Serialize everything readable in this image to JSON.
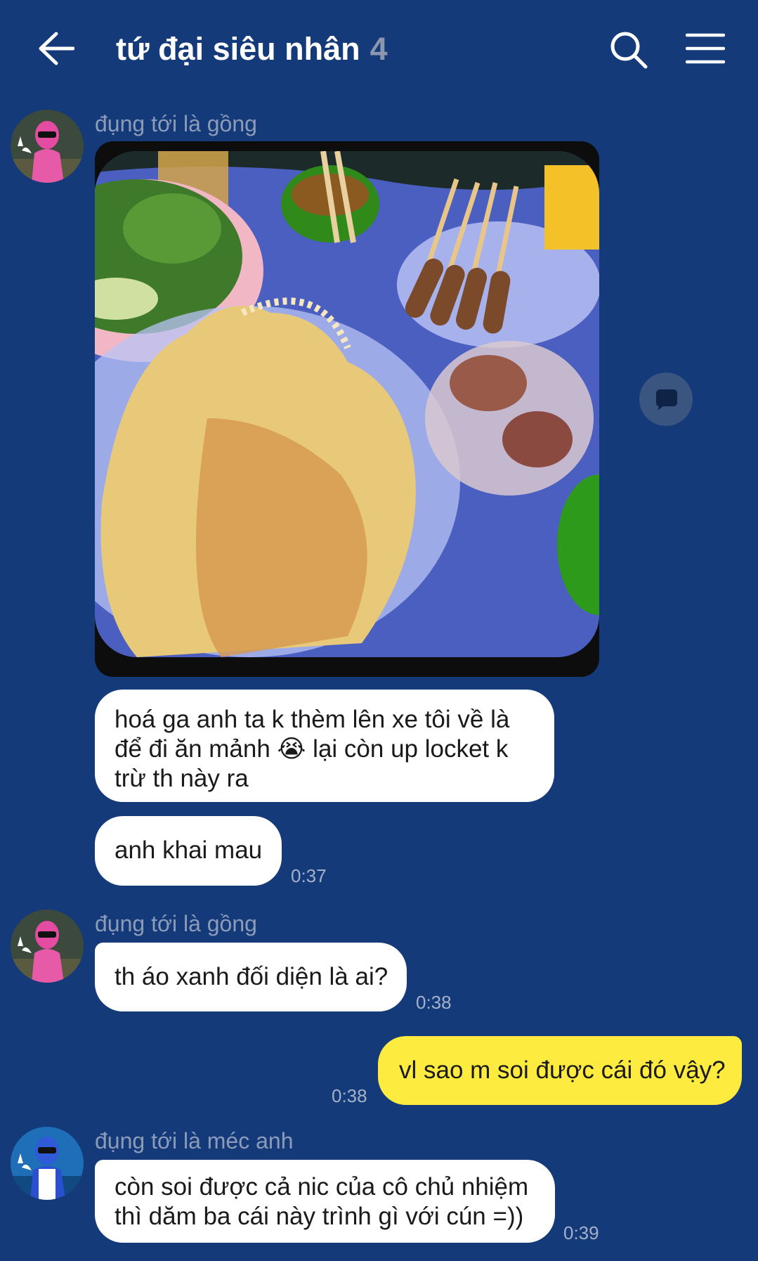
{
  "header": {
    "title": "tứ đại siêu nhân",
    "member_count": "4",
    "icons": {
      "back": "arrow-left-icon",
      "search": "search-icon",
      "menu": "hamburger-menu-icon"
    }
  },
  "messages": [
    {
      "sender": "đụng tới là gồng",
      "type": "image",
      "image_alt": "banh-xeo-food-photo"
    },
    {
      "type": "text",
      "text_lines": [
        "hoá ga anh ta k thèm lên xe tôi về là",
        "để đi ăn mảnh 😭 lại còn up locket k",
        "trừ th này ra"
      ]
    },
    {
      "type": "text",
      "text": "anh khai mau",
      "time": "0:37"
    },
    {
      "sender": "đụng tới là gồng",
      "type": "text",
      "text": "th áo xanh đối diện là ai?",
      "time": "0:38"
    },
    {
      "from_me": true,
      "type": "text",
      "text": "vl sao m soi được cái đó vậy?",
      "time": "0:38"
    },
    {
      "sender": "đụng tới là méc anh",
      "type": "text",
      "text_lines": [
        "còn soi được cả nic của cô chủ nhiệm",
        "thì dăm ba cái này trình gì với cún =))"
      ],
      "time": "0:39"
    }
  ],
  "colors": {
    "background": "#143a7a",
    "bubble_incoming": "#ffffff",
    "bubble_outgoing": "#fdec3f",
    "sender": "#8c9bb8",
    "time": "#a4b1cb"
  }
}
